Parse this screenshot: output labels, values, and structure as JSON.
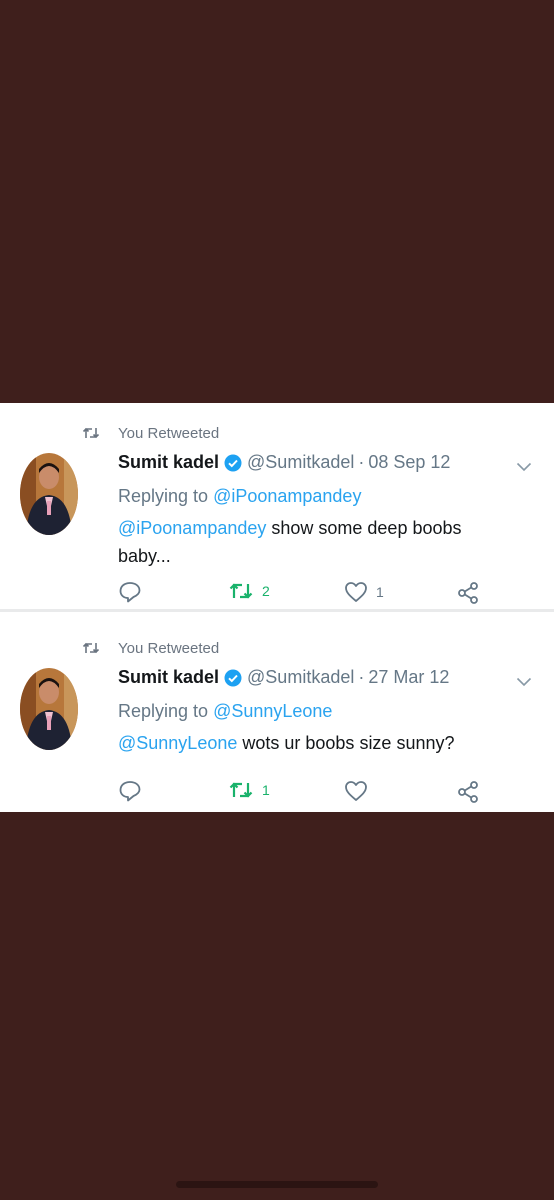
{
  "colors": {
    "background": "#3f1f1c",
    "card": "#ffffff",
    "link": "#2aa3ef",
    "retweet_active": "#19b26b",
    "muted": "#657786",
    "verified": "#1da1f2"
  },
  "tweets": [
    {
      "retweet_label": "You Retweeted",
      "name": "Sumit kadel",
      "handle": "@Sumitkadel",
      "separator": "·",
      "date": "08 Sep 12",
      "replying_prefix": "Replying to",
      "replying_to": "@iPoonampandey",
      "mention": "@iPoonampandey",
      "text": " show some deep boobs baby...",
      "retweet_count": "2",
      "like_count": "1",
      "icons": [
        "retweet-icon",
        "verified-badge-icon",
        "chevron-down-icon",
        "reply-icon",
        "retweet-icon",
        "like-icon",
        "share-icon"
      ]
    },
    {
      "retweet_label": "You Retweeted",
      "name": "Sumit kadel",
      "handle": "@Sumitkadel",
      "separator": "·",
      "date": "27 Mar 12",
      "replying_prefix": "Replying to",
      "replying_to": "@SunnyLeone",
      "mention": "@SunnyLeone",
      "text": " wots ur boobs size sunny?",
      "retweet_count": "1",
      "like_count": "",
      "icons": [
        "retweet-icon",
        "verified-badge-icon",
        "chevron-down-icon",
        "reply-icon",
        "retweet-icon",
        "like-icon",
        "share-icon"
      ]
    }
  ]
}
